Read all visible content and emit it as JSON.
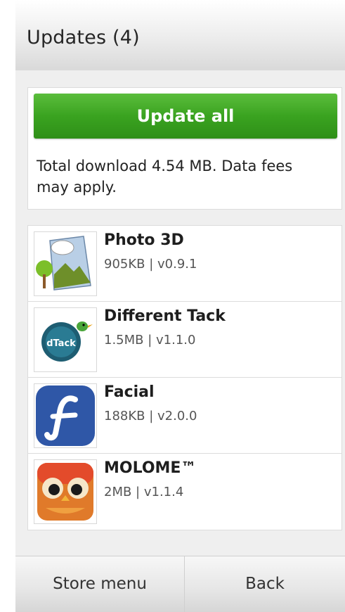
{
  "header": {
    "title": "Updates (4)"
  },
  "update_panel": {
    "button_label": "Update all",
    "info": "Total download 4.54 MB. Data fees may apply."
  },
  "apps": [
    {
      "name": "Photo 3D",
      "meta": "905KB | v0.9.1",
      "icon": "photo-3d-icon"
    },
    {
      "name": "Different Tack",
      "meta": "1.5MB | v1.1.0",
      "icon": "different-tack-icon"
    },
    {
      "name": "Facial",
      "meta": "188KB | v2.0.0",
      "icon": "facial-icon"
    },
    {
      "name": "MOLOME™",
      "meta": "2MB | v1.1.4",
      "icon": "molome-icon"
    }
  ],
  "footer": {
    "left_label": "Store menu",
    "right_label": "Back"
  },
  "colors": {
    "accent_green": "#3aa320"
  }
}
